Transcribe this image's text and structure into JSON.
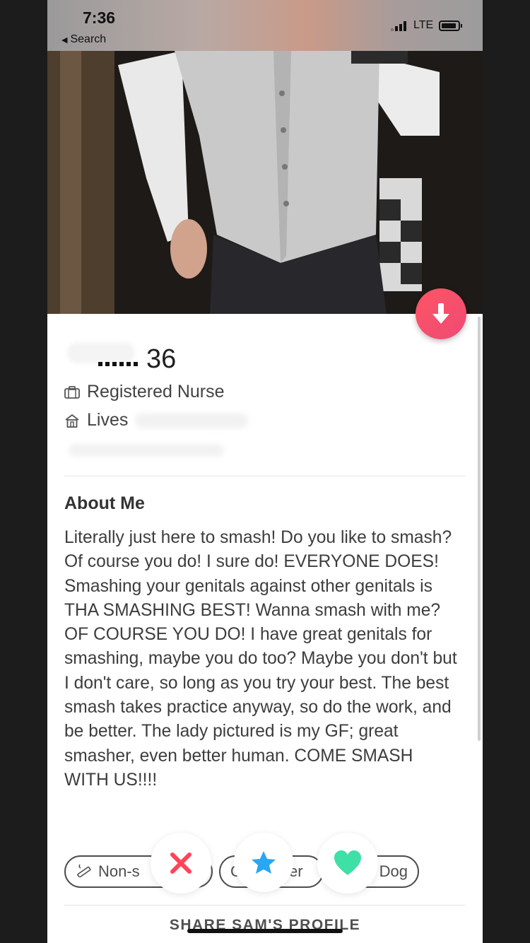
{
  "status_bar": {
    "time": "7:36",
    "back_label": "Search",
    "network": "LTE"
  },
  "profile": {
    "age": "36",
    "job": "Registered Nurse",
    "lives_label": "Lives"
  },
  "about": {
    "title": "About Me",
    "text": "Literally just here to smash!  Do you like to smash? Of course you do!  I sure do! EVERYONE DOES!  Smashing your genitals against other genitals is THA SMASHING BEST!  Wanna smash with me?  OF COURSE YOU DO!  I have great genitals for smashing, maybe you do too?  Maybe you don't but I don't care, so long as you try your best.  The best smash takes practice anyway, so do the work, and be better.  The lady pictured is my GF; great smasher, even better human. COME SMASH WITH US!!!!"
  },
  "passions": {
    "pill1": "Non-s",
    "pill2_left": "C",
    "pill2_right": "ıcer",
    "pill3": "Dog"
  },
  "actions": {
    "share_label": "SHARE SAM'S PROFILE"
  },
  "colors": {
    "accent": "#fd5564",
    "nope": "#ff4458",
    "superlike": "#2aa7f0",
    "like": "#3fe0a5"
  },
  "icons": {
    "down": "arrow-down-icon",
    "job": "briefcase-icon",
    "home": "home-icon",
    "smoking": "smoking-icon",
    "nope": "x-icon",
    "superlike": "star-icon",
    "like": "heart-icon"
  }
}
